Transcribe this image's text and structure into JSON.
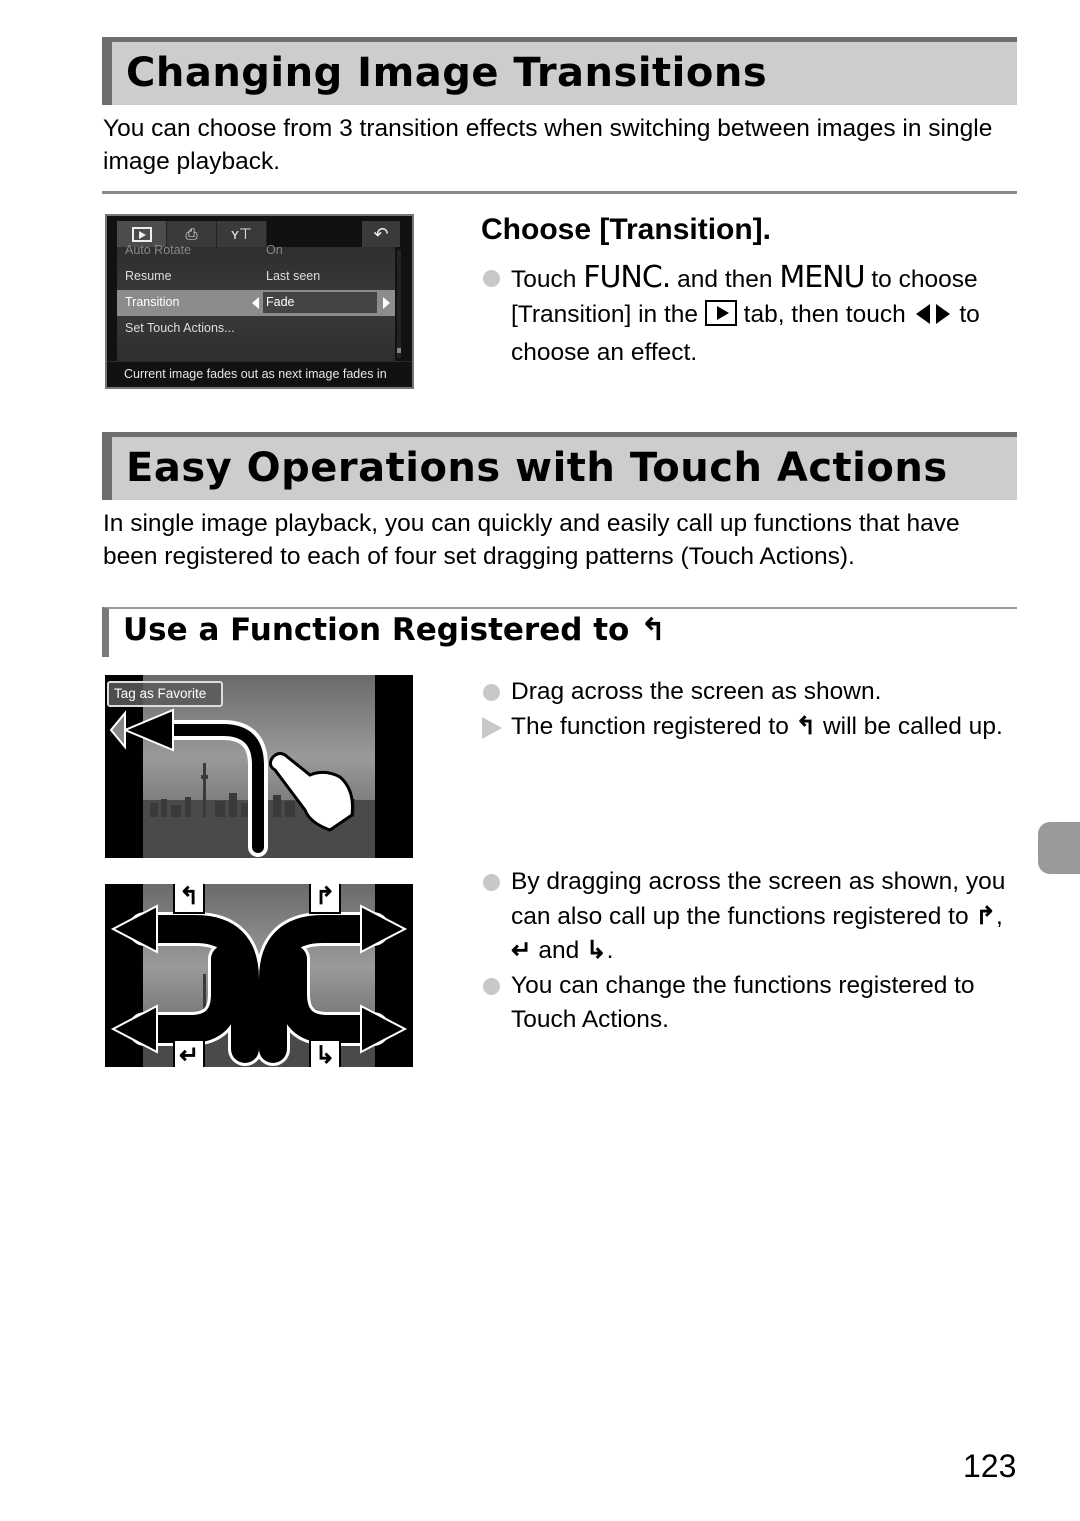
{
  "section1": {
    "title": "Changing Image Transitions",
    "intro": "You can choose from 3 transition effects when switching between images in single image playback.",
    "step_title": "Choose [Transition].",
    "bullet": {
      "t1": "Touch ",
      "func": "FUNC.",
      "t2": " and then ",
      "menu": "MENU",
      "t3": " to choose [Transition] in the ",
      "t4": " tab, then touch ",
      "t5": " to choose an effect."
    }
  },
  "camera_menu": {
    "tabs": [
      {
        "icon": "playback-icon",
        "glyph": "▶"
      },
      {
        "icon": "print-icon",
        "glyph": "⎙"
      },
      {
        "icon": "tools-icon",
        "glyph": "ʏ⊤"
      }
    ],
    "back_glyph": "↶",
    "rows": [
      {
        "label": "Auto Rotate",
        "value": "On"
      },
      {
        "label": "Resume",
        "value": "Last seen"
      },
      {
        "label": "Transition",
        "value": "Fade",
        "selected": true
      },
      {
        "label": "Set Touch Actions...",
        "value": ""
      }
    ],
    "help": "Current image fades out as next image fades in"
  },
  "section2": {
    "title": "Easy Operations with Touch Actions",
    "intro": "In single image playback, you can quickly and easily call up functions that have been registered to each of four set dragging patterns (Touch Actions).",
    "subhead": "Use a Function Registered to",
    "subhead_icon": "↰",
    "bullets_a": [
      {
        "type": "dot",
        "text": "Drag across the screen as shown."
      },
      {
        "type": "result",
        "t1": "The function registered to ",
        "icon": "↰",
        "t2": " will be called up."
      }
    ],
    "bullets_b": [
      {
        "type": "dot",
        "t1": "By dragging across the screen as shown, you can also call up the functions registered to ",
        "icon1": "↱",
        "sep1": ", ",
        "icon2": "↵",
        "sep2": " and ",
        "icon3": "↳",
        "end": "."
      },
      {
        "type": "dot",
        "text": "You can change the functions registered to Touch Actions."
      }
    ],
    "illustration1_label": "Tag as Favorite",
    "illustration2_icons": [
      "↰",
      "↱",
      "↵",
      "↳"
    ]
  },
  "page_number": "123"
}
